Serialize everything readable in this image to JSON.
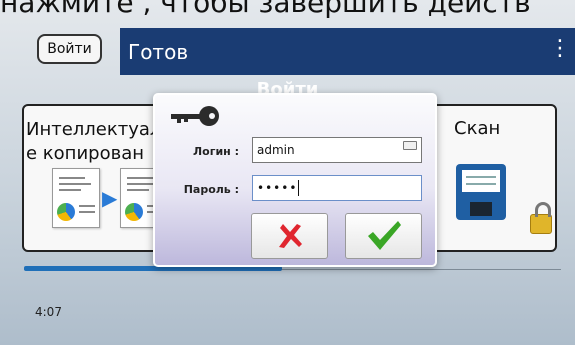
{
  "instruction_text": "нажмите        , чтобы завершить действ",
  "header": {
    "login_button_label": "Войти",
    "status_text": "Готов",
    "menu_icon": "kebab-menu-icon"
  },
  "section_title": "Войти",
  "tiles": [
    {
      "label": "Интеллектуал\n е копирован",
      "icons": [
        "document-icon",
        "arrow-right-icon",
        "document-icon"
      ]
    },
    {
      "label": "Скан",
      "icons": [
        "floppy-disk-icon",
        "lock-icon"
      ]
    }
  ],
  "progress": {
    "value": 0.48
  },
  "time_text": "4:07",
  "login_dialog": {
    "icon": "key-icon",
    "login_label": "Логин :",
    "login_value": "admin",
    "password_label": "Пароль :",
    "password_value": "•••••",
    "cancel_icon": "red-x-icon",
    "ok_icon": "green-check-icon"
  },
  "colors": {
    "status_bar": "#1a3c73",
    "progress": "#1f6fb8",
    "cancel": "#e0262f",
    "ok": "#3aa626"
  }
}
